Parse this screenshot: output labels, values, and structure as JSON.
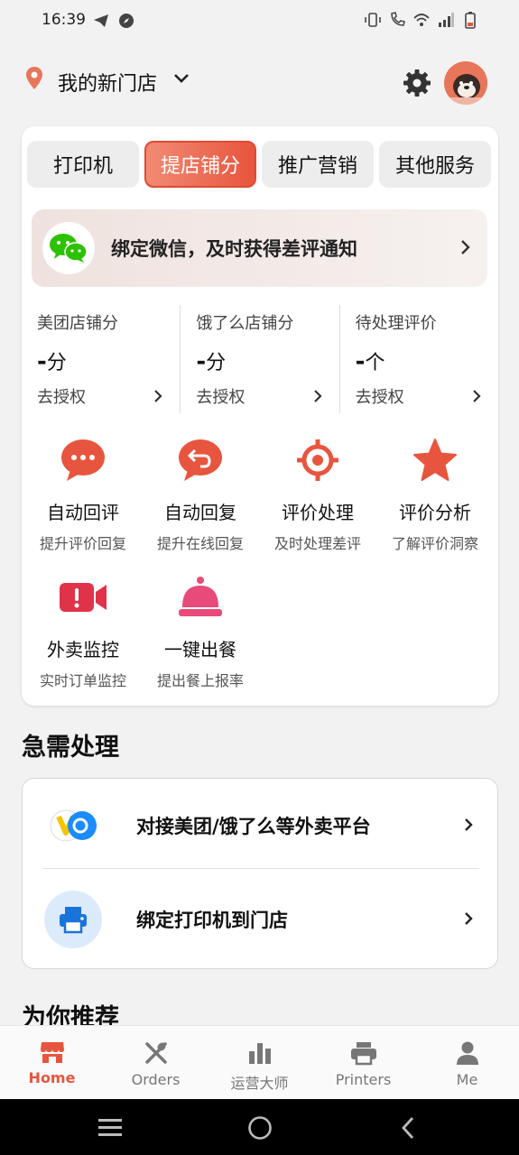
{
  "status_bar": {
    "time": "16:39"
  },
  "header": {
    "store_name": "我的新门店"
  },
  "tabs": [
    {
      "label": "打印机",
      "active": false
    },
    {
      "label": "提店铺分",
      "active": true
    },
    {
      "label": "推广营销",
      "active": false
    },
    {
      "label": "其他服务",
      "active": false
    }
  ],
  "wechat_banner": {
    "text": "绑定微信，及时获得差评通知"
  },
  "scores": [
    {
      "title": "美团店铺分",
      "value": "-",
      "unit": "分",
      "action": "去授权"
    },
    {
      "title": "饿了么店铺分",
      "value": "-",
      "unit": "分",
      "action": "去授权"
    },
    {
      "title": "待处理评价",
      "value": "-",
      "unit": "个",
      "action": "去授权"
    }
  ],
  "features": [
    {
      "title": "自动回评",
      "subtitle": "提升评价回复",
      "icon": "chat-bubble-icon"
    },
    {
      "title": "自动回复",
      "subtitle": "提升在线回复",
      "icon": "reply-bubble-icon"
    },
    {
      "title": "评价处理",
      "subtitle": "及时处理差评",
      "icon": "target-icon"
    },
    {
      "title": "评价分析",
      "subtitle": "了解评价洞察",
      "icon": "star-icon"
    },
    {
      "title": "外卖监控",
      "subtitle": "实时订单监控",
      "icon": "video-alert-icon"
    },
    {
      "title": "一键出餐",
      "subtitle": "提出餐上报率",
      "icon": "service-bell-icon"
    }
  ],
  "urgent": {
    "title": "急需处理",
    "items": [
      {
        "text": "对接美团/饿了么等外卖平台",
        "icon": "platform-logos-icon"
      },
      {
        "text": "绑定打印机到门店",
        "icon": "printer-icon"
      }
    ]
  },
  "recommend": {
    "title": "为你推荐"
  },
  "bottom_nav": [
    {
      "label": "Home",
      "active": true,
      "icon": "store-icon"
    },
    {
      "label": "Orders",
      "active": false,
      "icon": "utensils-icon"
    },
    {
      "label": "运营大师",
      "active": false,
      "icon": "bar-chart-icon"
    },
    {
      "label": "Printers",
      "active": false,
      "icon": "printer-icon"
    },
    {
      "label": "Me",
      "active": false,
      "icon": "person-icon"
    }
  ],
  "colors": {
    "accent": "#e8553e",
    "nav_inactive": "#777777",
    "wechat_green": "#2dc100"
  }
}
